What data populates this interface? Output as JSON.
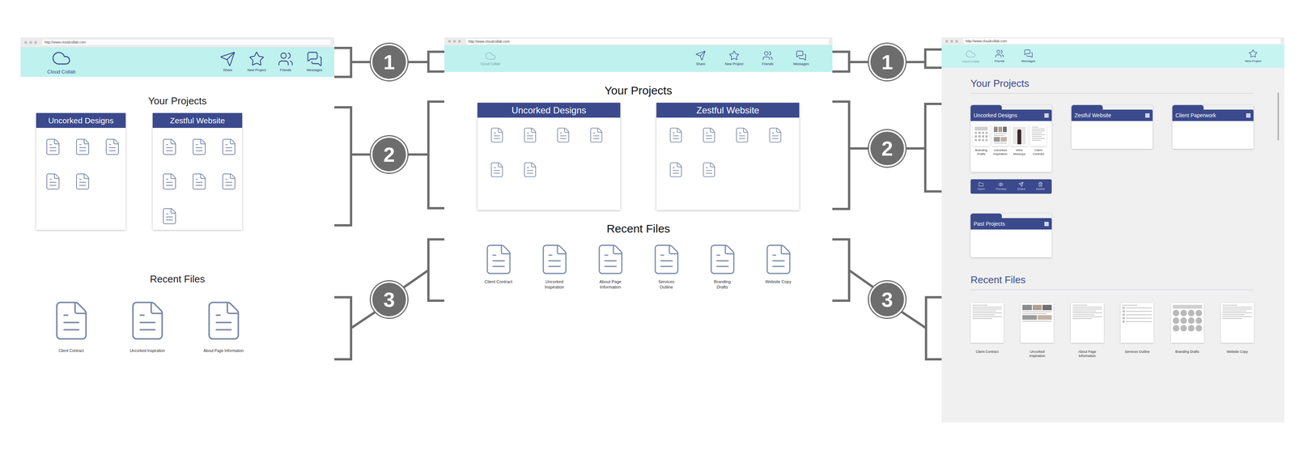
{
  "transitions": [
    {
      "callouts": [
        "1",
        "2",
        "3"
      ]
    },
    {
      "callouts": [
        "1",
        "2",
        "3"
      ]
    }
  ],
  "mockups": [
    {
      "kind": "sketch",
      "url": "http://www.cloudcollab.com",
      "logo": "Cloud Collab",
      "nav": [
        {
          "label": "Share"
        },
        {
          "label": "New Project"
        },
        {
          "label": "Friends"
        },
        {
          "label": "Messages"
        }
      ],
      "projects_title": "Your Projects",
      "projects": [
        {
          "name": "Uncorked Designs",
          "files": 5
        },
        {
          "name": "Zestful Website",
          "files": 7
        }
      ],
      "recent_title": "Recent Files",
      "recent_files": [
        {
          "label": "Client Contract"
        },
        {
          "label": "Uncorked Inspiration"
        },
        {
          "label": "About Page Information"
        }
      ]
    },
    {
      "kind": "wireframe",
      "url": "http://www.cloudcollab.com",
      "logo": "Cloud Collab",
      "nav": [
        {
          "label": "Share"
        },
        {
          "label": "New Project"
        },
        {
          "label": "Friends"
        },
        {
          "label": "Messages"
        }
      ],
      "projects_title": "Your Projects",
      "projects": [
        {
          "name": "Uncorked Designs",
          "files": 6
        },
        {
          "name": "Zestful Website",
          "files": 6
        }
      ],
      "recent_title": "Recent Files",
      "recent_files": [
        {
          "label": "Client Contract"
        },
        {
          "label": "Uncorked Inspiration"
        },
        {
          "label": "About Page Information"
        },
        {
          "label": "Services Outline"
        },
        {
          "label": "Branding Drafts"
        },
        {
          "label": "Website Copy"
        }
      ]
    },
    {
      "kind": "mockup",
      "url": "http://www.cloudcollab.com",
      "logo": "Cloud Collab",
      "left_nav": [
        {
          "label": "Friends"
        },
        {
          "label": "Messages"
        }
      ],
      "right_nav": [
        {
          "label": "New Project"
        }
      ],
      "projects_title": "Your Projects",
      "projects": [
        {
          "name": "Uncorked Designs",
          "expanded": true,
          "thumbnails": [
            {
              "label": "Branding Drafts",
              "kind": "swatches"
            },
            {
              "label": "Uncorked Inspiration",
              "kind": "photos"
            },
            {
              "label": "Wine Mockups",
              "kind": "photo"
            },
            {
              "label": "Client Contract",
              "kind": "text"
            }
          ],
          "actions": [
            {
              "label": "Open"
            },
            {
              "label": "Preview"
            },
            {
              "label": "Share"
            },
            {
              "label": "Delete"
            }
          ]
        },
        {
          "name": "Zestful Website",
          "expanded": false,
          "thumbnails": [],
          "actions": []
        },
        {
          "name": "Client Paperwork",
          "expanded": false,
          "thumbnails": [],
          "actions": []
        },
        {
          "name": "Past Projects",
          "expanded": false,
          "thumbnails": [],
          "actions": []
        }
      ],
      "recent_title": "Recent Files",
      "recent_files": [
        {
          "label": "Client Contract",
          "kind": "text"
        },
        {
          "label": "Uncorked Inspiration",
          "kind": "photos"
        },
        {
          "label": "About Page Information",
          "kind": "text"
        },
        {
          "label": "Services Outline",
          "kind": "list"
        },
        {
          "label": "Branding Drafts",
          "kind": "swatches"
        },
        {
          "label": "Website Copy",
          "kind": "text"
        }
      ]
    }
  ]
}
